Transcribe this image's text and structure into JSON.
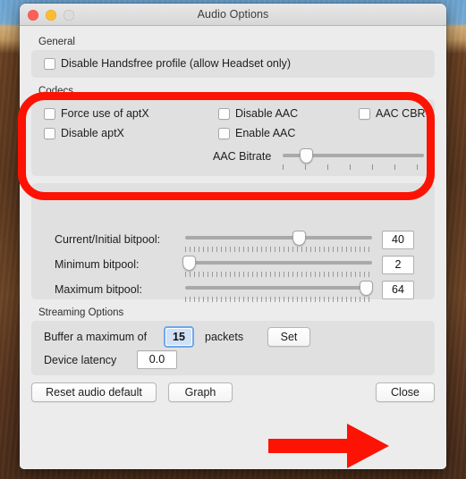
{
  "window": {
    "title": "Audio Options",
    "traffic_lights": [
      {
        "name": "close",
        "color": "#ff5f57"
      },
      {
        "name": "minimize",
        "color": "#ffbd2e"
      },
      {
        "name": "zoom",
        "color": "#dcdcdc"
      }
    ]
  },
  "general": {
    "label": "General",
    "checkboxes": [
      {
        "label": "Disable Handsfree profile (allow Headset only)",
        "checked": false
      }
    ]
  },
  "codecs": {
    "label": "Codecs",
    "checkboxes": [
      {
        "label": "Force use of aptX",
        "checked": false
      },
      {
        "label": "Disable aptX",
        "checked": false
      },
      {
        "label": "Disable AAC",
        "checked": false
      },
      {
        "label": "Enable AAC",
        "checked": false
      },
      {
        "label": "AAC CBR",
        "checked": false
      }
    ],
    "aac_bitrate": {
      "label": "AAC Bitrate",
      "thumb_percent": 17
    }
  },
  "bitpool": {
    "rows": [
      {
        "label": "Current/Initial bitpool:",
        "value": "40",
        "thumb_percent": 61
      },
      {
        "label": "Minimum bitpool:",
        "value": "2",
        "thumb_percent": 2
      },
      {
        "label": "Maximum bitpool:",
        "value": "64",
        "thumb_percent": 97
      }
    ]
  },
  "streaming": {
    "label": "Streaming Options",
    "buffer_prefix": "Buffer a maximum of",
    "buffer_value": "15",
    "buffer_suffix": "packets",
    "set_button": "Set",
    "latency_label": "Device latency",
    "latency_value": "0.0"
  },
  "footer": {
    "reset_button": "Reset audio default",
    "graph_button": "Graph",
    "close_button": "Close"
  },
  "annotations": {
    "highlight_color": "#fc1303",
    "codecs_box": "red-rounded-rectangle-around-codecs",
    "close_arrow": "red-arrow-pointing-to-close-button"
  }
}
